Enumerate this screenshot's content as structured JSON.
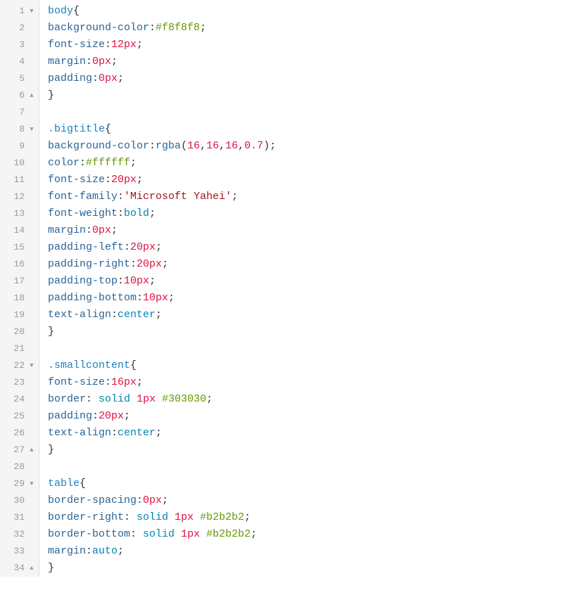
{
  "lines": [
    {
      "n": 1,
      "fold": "down",
      "tokens": [
        [
          "tag",
          "body"
        ],
        [
          "punc",
          "{"
        ]
      ]
    },
    {
      "n": 2,
      "fold": "",
      "tokens": [
        [
          "prop",
          "background-color"
        ],
        [
          "punc",
          ":"
        ],
        [
          "hex",
          "#f8f8f8"
        ],
        [
          "punc",
          ";"
        ]
      ]
    },
    {
      "n": 3,
      "fold": "",
      "tokens": [
        [
          "prop",
          "font-size"
        ],
        [
          "punc",
          ":"
        ],
        [
          "num",
          "12px"
        ],
        [
          "punc",
          ";"
        ]
      ]
    },
    {
      "n": 4,
      "fold": "",
      "tokens": [
        [
          "prop",
          "margin"
        ],
        [
          "punc",
          ":"
        ],
        [
          "num",
          "0px"
        ],
        [
          "punc",
          ";"
        ]
      ]
    },
    {
      "n": 5,
      "fold": "",
      "tokens": [
        [
          "prop",
          "padding"
        ],
        [
          "punc",
          ":"
        ],
        [
          "num",
          "0px"
        ],
        [
          "punc",
          ";"
        ]
      ]
    },
    {
      "n": 6,
      "fold": "up",
      "tokens": [
        [
          "punc",
          "}"
        ]
      ]
    },
    {
      "n": 7,
      "fold": "",
      "tokens": []
    },
    {
      "n": 8,
      "fold": "down",
      "tokens": [
        [
          "tag",
          ".bigtitle"
        ],
        [
          "punc",
          "{"
        ]
      ]
    },
    {
      "n": 9,
      "fold": "",
      "tokens": [
        [
          "prop",
          "background-color"
        ],
        [
          "punc",
          ":"
        ],
        [
          "func",
          "rgba"
        ],
        [
          "punc",
          "("
        ],
        [
          "num",
          "16"
        ],
        [
          "punc",
          ","
        ],
        [
          "num",
          "16"
        ],
        [
          "punc",
          ","
        ],
        [
          "num",
          "16"
        ],
        [
          "punc",
          ","
        ],
        [
          "num",
          "0.7"
        ],
        [
          "punc",
          ")"
        ],
        [
          "punc",
          ";"
        ]
      ]
    },
    {
      "n": 10,
      "fold": "",
      "tokens": [
        [
          "prop",
          "color"
        ],
        [
          "punc",
          ":"
        ],
        [
          "hex",
          "#ffffff"
        ],
        [
          "punc",
          ";"
        ]
      ]
    },
    {
      "n": 11,
      "fold": "",
      "tokens": [
        [
          "prop",
          "font-size"
        ],
        [
          "punc",
          ":"
        ],
        [
          "num",
          "20px"
        ],
        [
          "punc",
          ";"
        ]
      ]
    },
    {
      "n": 12,
      "fold": "",
      "tokens": [
        [
          "prop",
          "font-family"
        ],
        [
          "punc",
          ":"
        ],
        [
          "str",
          "'Microsoft Yahei'"
        ],
        [
          "punc",
          ";"
        ]
      ]
    },
    {
      "n": 13,
      "fold": "",
      "tokens": [
        [
          "prop",
          "font-weight"
        ],
        [
          "punc",
          ":"
        ],
        [
          "kw",
          "bold"
        ],
        [
          "punc",
          ";"
        ]
      ]
    },
    {
      "n": 14,
      "fold": "",
      "tokens": [
        [
          "prop",
          "margin"
        ],
        [
          "punc",
          ":"
        ],
        [
          "num",
          "0px"
        ],
        [
          "punc",
          ";"
        ]
      ]
    },
    {
      "n": 15,
      "fold": "",
      "tokens": [
        [
          "prop",
          "padding-left"
        ],
        [
          "punc",
          ":"
        ],
        [
          "num",
          "20px"
        ],
        [
          "punc",
          ";"
        ]
      ]
    },
    {
      "n": 16,
      "fold": "",
      "tokens": [
        [
          "prop",
          "padding-right"
        ],
        [
          "punc",
          ":"
        ],
        [
          "num",
          "20px"
        ],
        [
          "punc",
          ";"
        ]
      ]
    },
    {
      "n": 17,
      "fold": "",
      "tokens": [
        [
          "prop",
          "padding-top"
        ],
        [
          "punc",
          ":"
        ],
        [
          "num",
          "10px"
        ],
        [
          "punc",
          ";"
        ]
      ]
    },
    {
      "n": 18,
      "fold": "",
      "tokens": [
        [
          "prop",
          "padding-bottom"
        ],
        [
          "punc",
          ":"
        ],
        [
          "num",
          "10px"
        ],
        [
          "punc",
          ";"
        ]
      ]
    },
    {
      "n": 19,
      "fold": "",
      "tokens": [
        [
          "prop",
          "text-align"
        ],
        [
          "punc",
          ":"
        ],
        [
          "kw",
          "center"
        ],
        [
          "punc",
          ";"
        ]
      ]
    },
    {
      "n": 20,
      "fold": "",
      "tokens": [
        [
          "punc",
          "}"
        ]
      ]
    },
    {
      "n": 21,
      "fold": "",
      "tokens": []
    },
    {
      "n": 22,
      "fold": "down",
      "tokens": [
        [
          "tag",
          ".smallcontent"
        ],
        [
          "punc",
          "{"
        ]
      ]
    },
    {
      "n": 23,
      "fold": "",
      "tokens": [
        [
          "prop",
          "font-size"
        ],
        [
          "punc",
          ":"
        ],
        [
          "num",
          "16px"
        ],
        [
          "punc",
          ";"
        ]
      ]
    },
    {
      "n": 24,
      "fold": "",
      "tokens": [
        [
          "prop",
          "border"
        ],
        [
          "punc",
          ": "
        ],
        [
          "kw",
          "solid"
        ],
        [
          "punc",
          " "
        ],
        [
          "num",
          "1px"
        ],
        [
          "punc",
          " "
        ],
        [
          "hex",
          "#303030"
        ],
        [
          "punc",
          ";"
        ]
      ]
    },
    {
      "n": 25,
      "fold": "",
      "tokens": [
        [
          "prop",
          "padding"
        ],
        [
          "punc",
          ":"
        ],
        [
          "num",
          "20px"
        ],
        [
          "punc",
          ";"
        ]
      ]
    },
    {
      "n": 26,
      "fold": "",
      "tokens": [
        [
          "prop",
          "text-align"
        ],
        [
          "punc",
          ":"
        ],
        [
          "kw",
          "center"
        ],
        [
          "punc",
          ";"
        ]
      ]
    },
    {
      "n": 27,
      "fold": "up",
      "tokens": [
        [
          "punc",
          "}"
        ]
      ]
    },
    {
      "n": 28,
      "fold": "",
      "tokens": []
    },
    {
      "n": 29,
      "fold": "down",
      "tokens": [
        [
          "tag",
          "table"
        ],
        [
          "punc",
          "{"
        ]
      ]
    },
    {
      "n": 30,
      "fold": "",
      "tokens": [
        [
          "prop",
          "border-spacing"
        ],
        [
          "punc",
          ":"
        ],
        [
          "num",
          "0px"
        ],
        [
          "punc",
          ";"
        ]
      ]
    },
    {
      "n": 31,
      "fold": "",
      "tokens": [
        [
          "prop",
          "border-right"
        ],
        [
          "punc",
          ": "
        ],
        [
          "kw",
          "solid"
        ],
        [
          "punc",
          " "
        ],
        [
          "num",
          "1px"
        ],
        [
          "punc",
          " "
        ],
        [
          "hex",
          "#b2b2b2"
        ],
        [
          "punc",
          ";"
        ]
      ]
    },
    {
      "n": 32,
      "fold": "",
      "tokens": [
        [
          "prop",
          "border-bottom"
        ],
        [
          "punc",
          ": "
        ],
        [
          "kw",
          "solid"
        ],
        [
          "punc",
          " "
        ],
        [
          "num",
          "1px"
        ],
        [
          "punc",
          " "
        ],
        [
          "hex",
          "#b2b2b2"
        ],
        [
          "punc",
          ";"
        ]
      ]
    },
    {
      "n": 33,
      "fold": "",
      "tokens": [
        [
          "prop",
          "margin"
        ],
        [
          "punc",
          ":"
        ],
        [
          "kw",
          "auto"
        ],
        [
          "punc",
          ";"
        ]
      ]
    },
    {
      "n": 34,
      "fold": "up",
      "tokens": [
        [
          "punc",
          "}"
        ]
      ]
    }
  ],
  "foldGlyph": {
    "down": "▼",
    "up": "▲",
    "": ""
  }
}
